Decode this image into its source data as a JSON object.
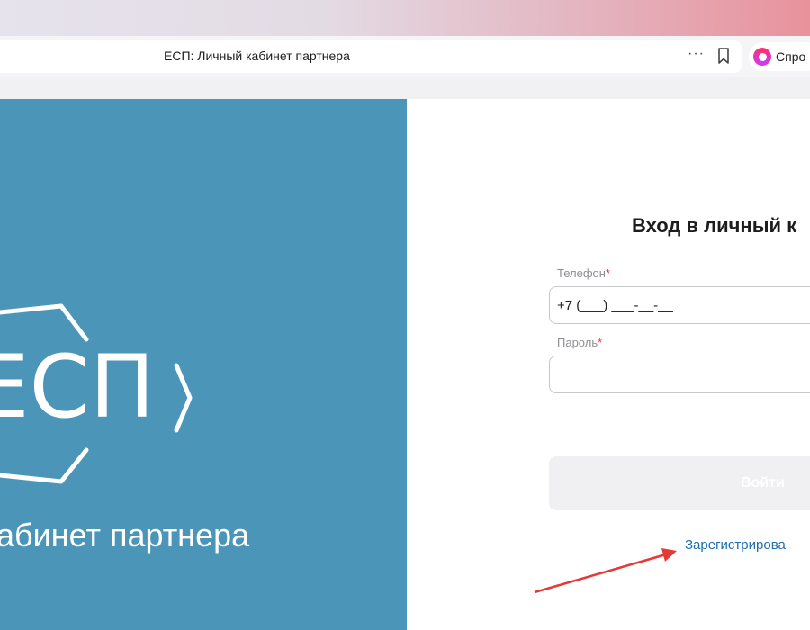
{
  "browser": {
    "tab_title": "ЕСП: Личный кабинет партнера",
    "more_glyph": "···",
    "ask_label": "Спро"
  },
  "brand": {
    "logo_text": "ЕСП",
    "caption": "абинет партнера",
    "panel_color": "#4a95b8"
  },
  "login": {
    "heading": "Вход в личный к",
    "phone_label": "Телефон",
    "phone_value": "+7 (___) ___-__-__",
    "password_label": "Пароль",
    "password_value": "",
    "required_mark": "*",
    "submit_label": "Войти",
    "register_link": "Зарегистрирова"
  },
  "colors": {
    "accent_link": "#1f6fa8",
    "required": "#e53935",
    "annotation_arrow": "#e53935"
  }
}
